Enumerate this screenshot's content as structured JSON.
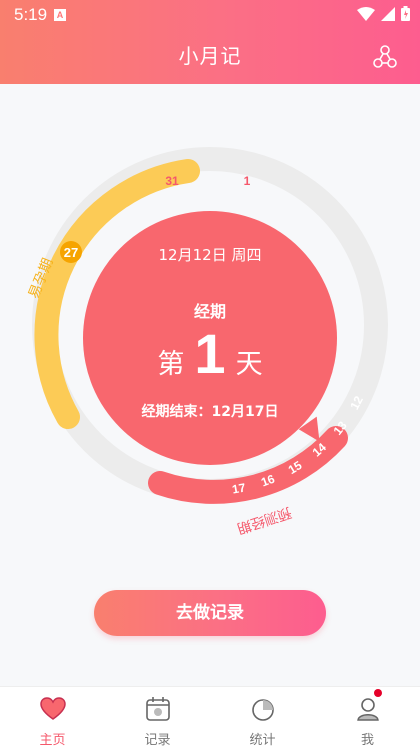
{
  "status_bar": {
    "time": "5:19",
    "notification_badge": "A"
  },
  "header": {
    "title": "小月记",
    "share_icon": "share-nodes-icon"
  },
  "cycle": {
    "fertile_label": "易孕期",
    "fertile_marker": "27",
    "fertile_end_day": "31",
    "cycle_start_day": "1",
    "predicted_label": "预测经期",
    "predicted_days": [
      "12",
      "13",
      "14",
      "15",
      "16",
      "17"
    ]
  },
  "summary": {
    "date": "12月12日 周四",
    "phase": "经期",
    "day_prefix": "第",
    "day_number": "1",
    "day_suffix": "天",
    "end_text": "经期结束：12月17日"
  },
  "record_button": "去做记录",
  "tabs": [
    {
      "label": "主页",
      "icon": "heart-icon",
      "active": true
    },
    {
      "label": "记录",
      "icon": "calendar-icon",
      "active": false
    },
    {
      "label": "统计",
      "icon": "pie-chart-icon",
      "active": false
    },
    {
      "label": "我",
      "icon": "user-icon",
      "active": false
    }
  ],
  "colors": {
    "accent": "#f8676e",
    "fertile": "#fccb56",
    "track": "#ececec",
    "tab_active": "#f5586b"
  }
}
